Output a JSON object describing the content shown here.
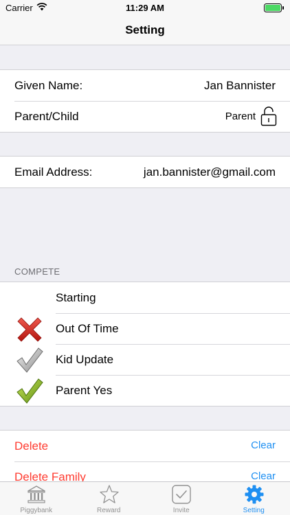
{
  "status_bar": {
    "carrier": "Carrier",
    "time": "11:29 AM"
  },
  "nav": {
    "title": "Setting"
  },
  "profile": {
    "given_name_label": "Given Name:",
    "given_name_value": "Jan Bannister",
    "role_label": "Parent/Child",
    "role_value": "Parent",
    "role_icon": "lock-icon"
  },
  "contact": {
    "email_label": "Email Address:",
    "email_value": "jan.bannister@gmail.com"
  },
  "compete": {
    "header": "COMPETE",
    "items": [
      {
        "label": "Starting",
        "icon": ""
      },
      {
        "label": "Out Of Time",
        "icon": "red-x-icon"
      },
      {
        "label": "Kid Update",
        "icon": "gray-check-icon"
      },
      {
        "label": "Parent Yes",
        "icon": "green-check-icon"
      }
    ]
  },
  "actions": [
    {
      "label": "Delete",
      "action": "Clear"
    },
    {
      "label": "Delete Family",
      "action": "Clear"
    }
  ],
  "tabs": [
    {
      "label": "Piggybank",
      "icon": "bank-icon"
    },
    {
      "label": "Reward",
      "icon": "star-icon"
    },
    {
      "label": "Invite",
      "icon": "checkbox-icon"
    },
    {
      "label": "Setting",
      "icon": "gear-icon",
      "active": true
    }
  ],
  "colors": {
    "accent": "#1e8ff2",
    "destructive": "#ff3b30",
    "background": "#efeff4"
  }
}
